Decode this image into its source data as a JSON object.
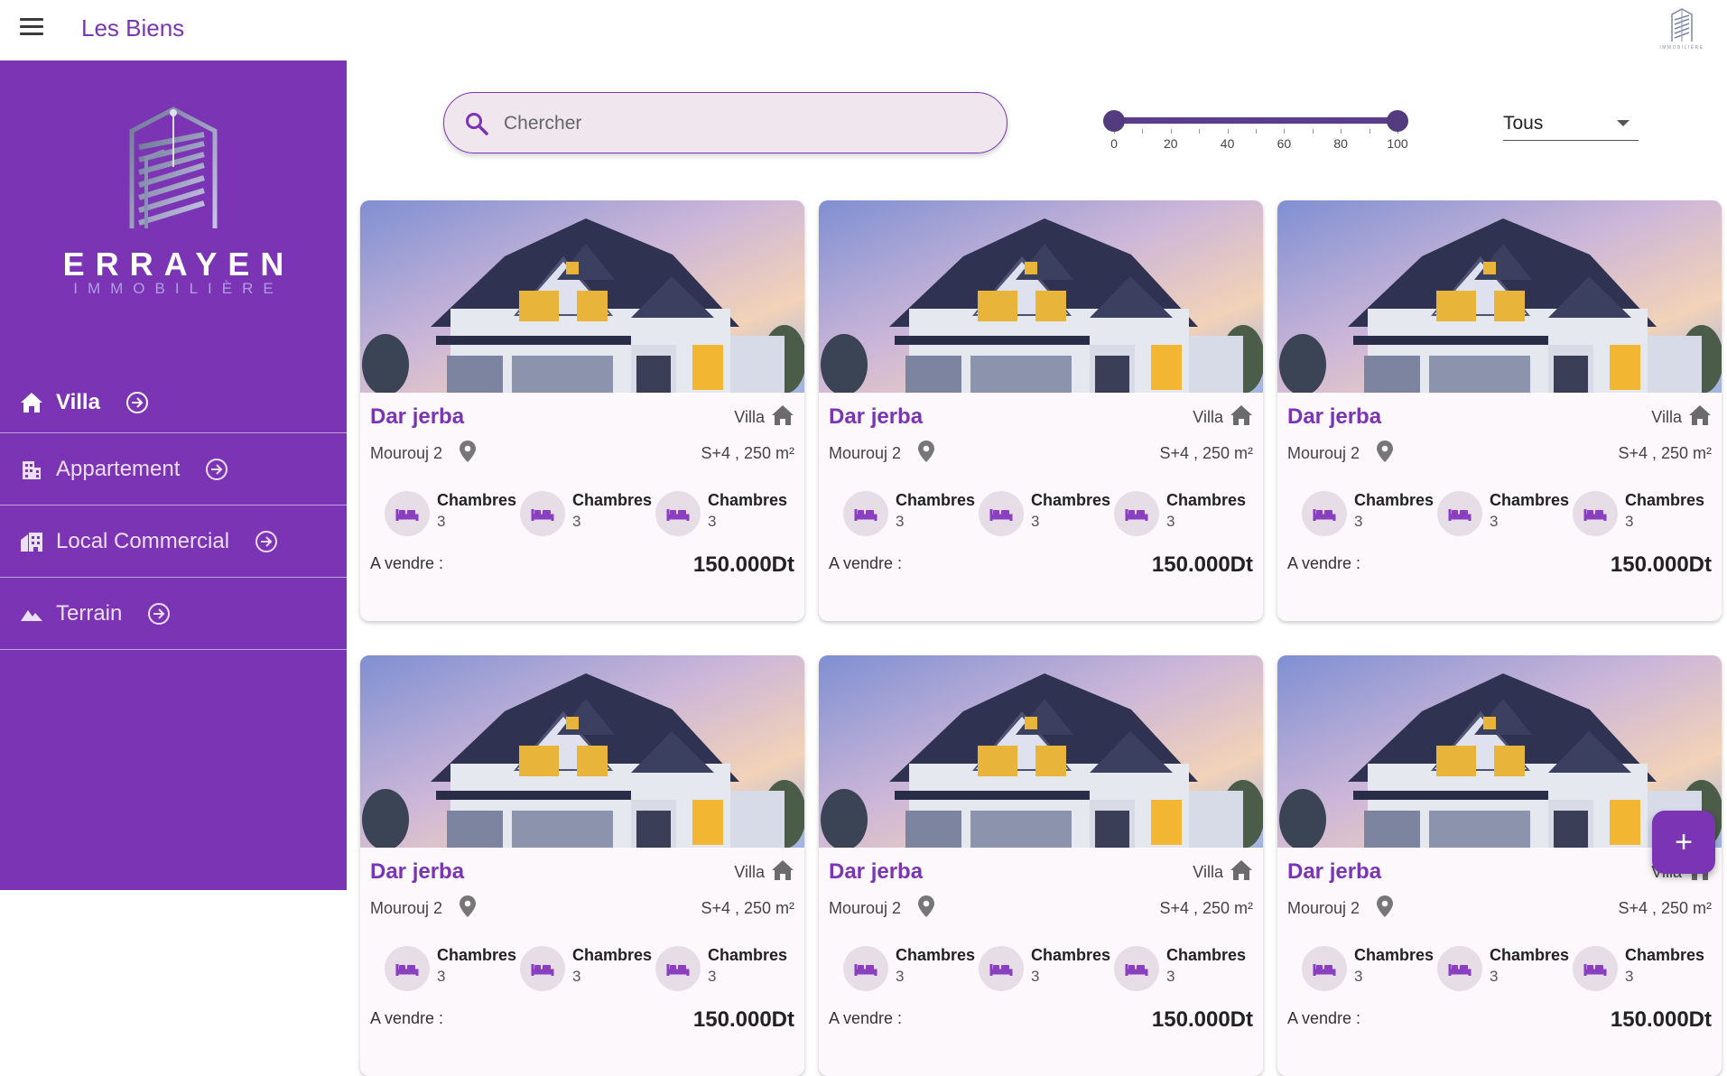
{
  "header": {
    "title": "Les Biens",
    "menu_icon": "menu-icon",
    "corner_logo_text": "IMMOBILIÈRE"
  },
  "sidebar": {
    "brand": {
      "name": "ERRAYEN",
      "subtitle": "IMMOBILIÈRE"
    },
    "items": [
      {
        "label": "Villa",
        "icon": "home-icon",
        "active": true
      },
      {
        "label": "Appartement",
        "icon": "building-icon",
        "active": false
      },
      {
        "label": "Local Commercial",
        "icon": "store-icon",
        "active": false
      },
      {
        "label": "Terrain",
        "icon": "landscape-icon",
        "active": false
      }
    ]
  },
  "filters": {
    "search": {
      "placeholder": "Chercher",
      "value": ""
    },
    "price_range": {
      "min": 0,
      "max": 100,
      "low": 0,
      "high": 100,
      "ticks": [
        "0",
        "20",
        "40",
        "60",
        "80",
        "100"
      ]
    },
    "type_select": {
      "value": "Tous"
    }
  },
  "properties": [
    {
      "title": "Dar jerba",
      "type": "Villa",
      "location": "Mourouj 2",
      "spec": "S+4 ,  250 m²",
      "features": [
        {
          "label": "Chambres",
          "value": "3"
        },
        {
          "label": "Chambres",
          "value": "3"
        },
        {
          "label": "Chambres",
          "value": "3"
        }
      ],
      "status": "A vendre :",
      "price": "150.000Dt"
    },
    {
      "title": "Dar jerba",
      "type": "Villa",
      "location": "Mourouj 2",
      "spec": "S+4 ,  250 m²",
      "features": [
        {
          "label": "Chambres",
          "value": "3"
        },
        {
          "label": "Chambres",
          "value": "3"
        },
        {
          "label": "Chambres",
          "value": "3"
        }
      ],
      "status": "A vendre :",
      "price": "150.000Dt"
    },
    {
      "title": "Dar jerba",
      "type": "Villa",
      "location": "Mourouj 2",
      "spec": "S+4 ,  250 m²",
      "features": [
        {
          "label": "Chambres",
          "value": "3"
        },
        {
          "label": "Chambres",
          "value": "3"
        },
        {
          "label": "Chambres",
          "value": "3"
        }
      ],
      "status": "A vendre :",
      "price": "150.000Dt"
    },
    {
      "title": "Dar jerba",
      "type": "Villa",
      "location": "Mourouj 2",
      "spec": "S+4 ,  250 m²",
      "features": [
        {
          "label": "Chambres",
          "value": "3"
        },
        {
          "label": "Chambres",
          "value": "3"
        },
        {
          "label": "Chambres",
          "value": "3"
        }
      ],
      "status": "A vendre :",
      "price": "150.000Dt"
    },
    {
      "title": "Dar jerba",
      "type": "Villa",
      "location": "Mourouj 2",
      "spec": "S+4 ,  250 m²",
      "features": [
        {
          "label": "Chambres",
          "value": "3"
        },
        {
          "label": "Chambres",
          "value": "3"
        },
        {
          "label": "Chambres",
          "value": "3"
        }
      ],
      "status": "A vendre :",
      "price": "150.000Dt"
    },
    {
      "title": "Dar jerba",
      "type": "Villa",
      "location": "Mourouj 2",
      "spec": "S+4 ,  250 m²",
      "features": [
        {
          "label": "Chambres",
          "value": "3"
        },
        {
          "label": "Chambres",
          "value": "3"
        },
        {
          "label": "Chambres",
          "value": "3"
        }
      ],
      "status": "A vendre :",
      "price": "150.000Dt"
    }
  ],
  "fab": {
    "label": "+",
    "icon": "plus-icon"
  },
  "colors": {
    "primary": "#7b34b3",
    "slider": "#533b80",
    "search_bg": "#efe6ee",
    "card_bg": "#fcf8fb"
  }
}
